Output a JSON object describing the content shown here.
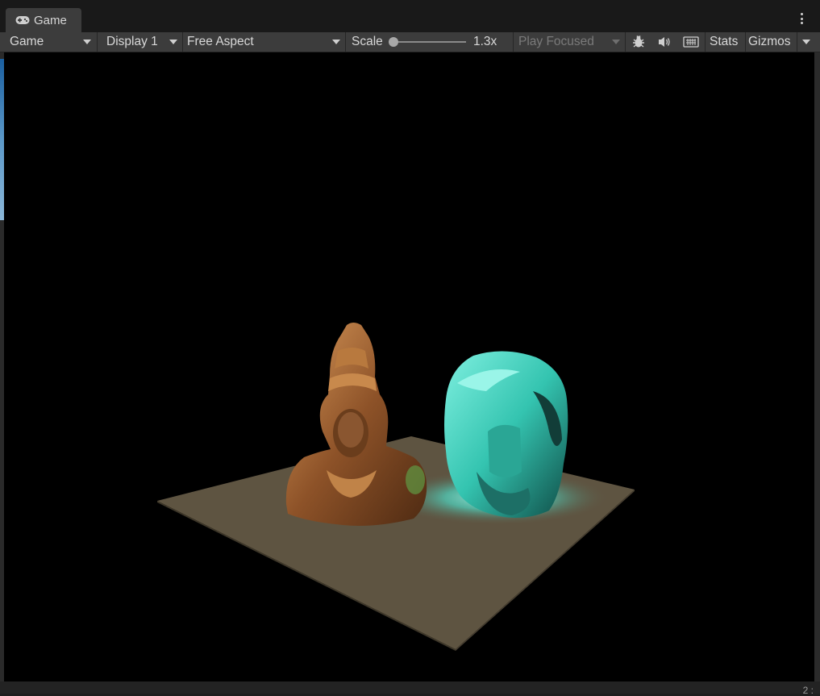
{
  "window": {
    "tab_label": "Game",
    "tab_icon": "gamepad-icon",
    "menu_icon": "kebab-menu-icon"
  },
  "toolbar": {
    "view_mode": "Game",
    "display": "Display 1",
    "aspect": "Free Aspect",
    "scale_label": "Scale",
    "scale_value": "1.3x",
    "scale_fraction": 0.0,
    "play_mode": "Play Focused",
    "stats_label": "Stats",
    "gizmos_label": "Gizmos",
    "icons": [
      "bug-icon",
      "audio-mute-icon",
      "keyboard-icon"
    ]
  },
  "scene": {
    "objects": [
      "bronze-bust",
      "cyan-head",
      "ground-plane"
    ],
    "colors": {
      "background": "#000000",
      "plane": "#5e5441",
      "bronze": "#9a5f30",
      "cyan": "#3ed6c4",
      "highlight": "#7ff0e0"
    }
  },
  "status": {
    "corner_text": "2 :"
  }
}
